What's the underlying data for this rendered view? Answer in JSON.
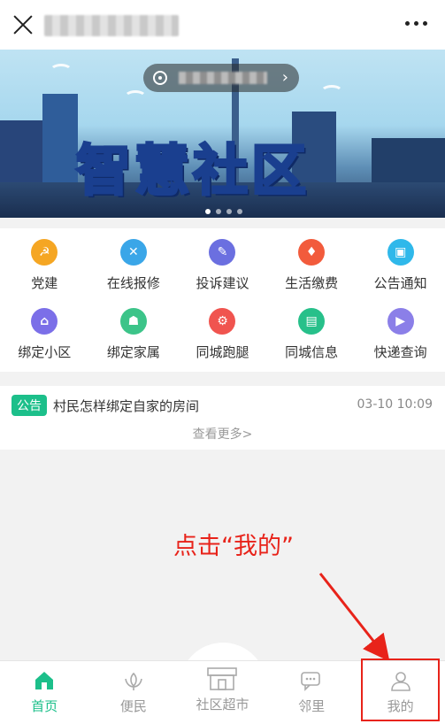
{
  "banner": {
    "title": "智慧社区"
  },
  "menu": {
    "items": [
      {
        "label": "党建",
        "icon": "party-flag-icon",
        "color": "#f5a623"
      },
      {
        "label": "在线报修",
        "icon": "tools-icon",
        "color": "#3aa6e8"
      },
      {
        "label": "投诉建议",
        "icon": "edit-icon",
        "color": "#6b6fe0"
      },
      {
        "label": "生活缴费",
        "icon": "flame-icon",
        "color": "#f25b3c"
      },
      {
        "label": "公告通知",
        "icon": "bag-icon",
        "color": "#2fb8ea"
      },
      {
        "label": "绑定小区",
        "icon": "community-icon",
        "color": "#7b6fe8"
      },
      {
        "label": "绑定家属",
        "icon": "family-icon",
        "color": "#3cc489"
      },
      {
        "label": "同城跑腿",
        "icon": "scooter-icon",
        "color": "#f0544f"
      },
      {
        "label": "同城信息",
        "icon": "id-card-icon",
        "color": "#27c08a"
      },
      {
        "label": "快递查询",
        "icon": "truck-icon",
        "color": "#8b7fe8"
      }
    ]
  },
  "notice": {
    "tag": "公告",
    "text": "村民怎样绑定自家的房间",
    "time": "03-10 10:09",
    "more": "查看更多>"
  },
  "annotation": {
    "text": "点击“我的”",
    "color": "#e8231a"
  },
  "tabs": [
    {
      "label": "首页",
      "icon": "home-icon",
      "active": true
    },
    {
      "label": "便民",
      "icon": "lotus-icon",
      "active": false
    },
    {
      "label": "社区超市",
      "icon": "store-icon",
      "active": false
    },
    {
      "label": "邻里",
      "icon": "chat-icon",
      "active": false
    },
    {
      "label": "我的",
      "icon": "user-icon",
      "active": false
    }
  ],
  "colors": {
    "accent": "#1cbf8a",
    "inactive": "#999999"
  }
}
